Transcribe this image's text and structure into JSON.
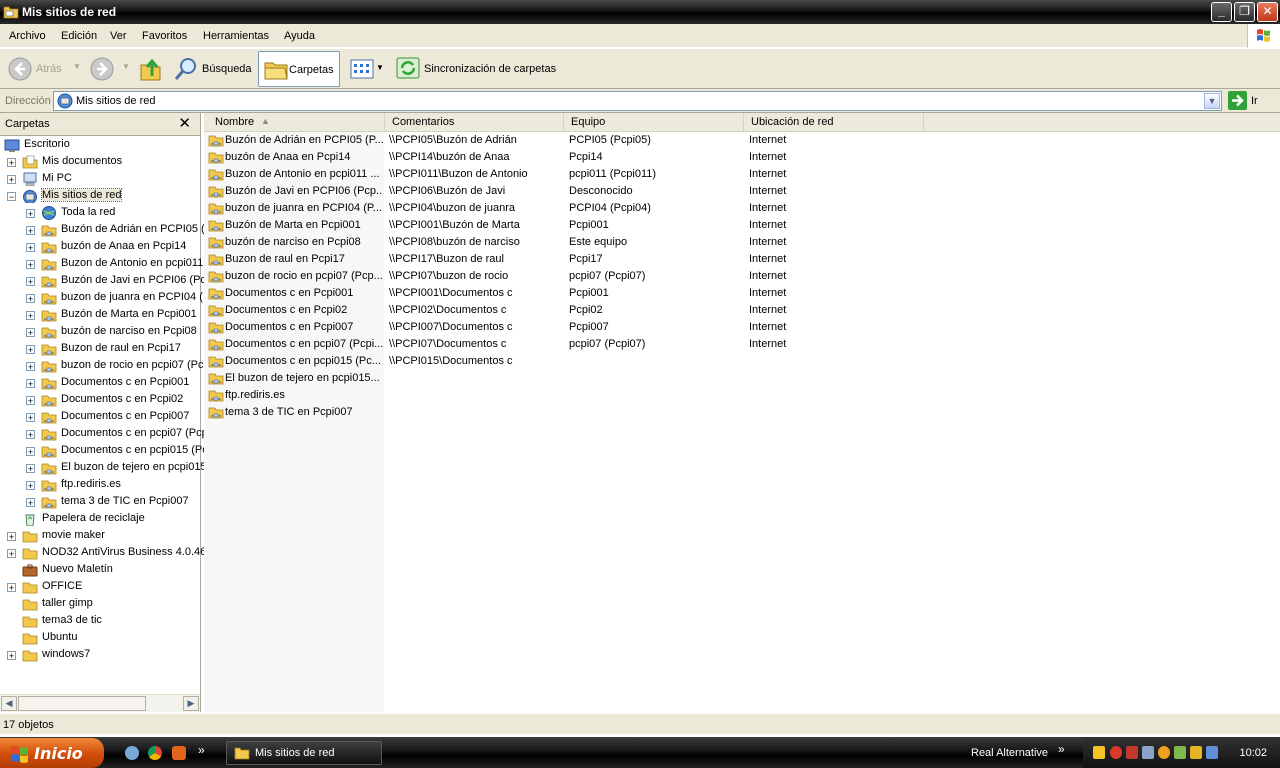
{
  "window": {
    "title": "Mis sitios de red",
    "controls": {
      "minimize": "_",
      "maximize": "❐",
      "close": "✕"
    }
  },
  "menu": [
    "Archivo",
    "Edición",
    "Ver",
    "Favoritos",
    "Herramientas",
    "Ayuda"
  ],
  "toolbar": {
    "back_label": "Atrás",
    "search_label": "Búsqueda",
    "folders_label": "Carpetas",
    "sync_label": "Sincronización de carpetas"
  },
  "address": {
    "label": "Dirección",
    "value": "Mis sitios de red",
    "go_label": "Ir"
  },
  "folder_pane": {
    "title": "Carpetas",
    "close_glyph": "✕",
    "tree": [
      {
        "label": "Escritorio",
        "level": 0,
        "expander": "",
        "icon": "desktop-icon"
      },
      {
        "label": "Mis documentos",
        "level": 1,
        "expander": "+",
        "icon": "my-documents-icon"
      },
      {
        "label": "Mi PC",
        "level": 1,
        "expander": "+",
        "icon": "my-computer-icon"
      },
      {
        "label": "Mis sitios de red",
        "level": 1,
        "expander": "−",
        "icon": "network-places-icon",
        "selected": true
      },
      {
        "label": "Toda la red",
        "level": 2,
        "expander": "+",
        "icon": "globe-icon"
      },
      {
        "label": "Buzón de Adrián en PCPI05 (",
        "level": 2,
        "expander": "+",
        "icon": "network-folder-icon"
      },
      {
        "label": "buzón de Anaa en Pcpi14",
        "level": 2,
        "expander": "+",
        "icon": "network-folder-icon"
      },
      {
        "label": "Buzon de Antonio en pcpi011",
        "level": 2,
        "expander": "+",
        "icon": "network-folder-icon"
      },
      {
        "label": "Buzón de Javi en PCPI06 (Pc",
        "level": 2,
        "expander": "+",
        "icon": "network-folder-icon"
      },
      {
        "label": "buzon de juanra en PCPI04 (",
        "level": 2,
        "expander": "+",
        "icon": "network-folder-icon"
      },
      {
        "label": "Buzón de Marta en Pcpi001",
        "level": 2,
        "expander": "+",
        "icon": "network-folder-icon"
      },
      {
        "label": "buzón de narciso en Pcpi08",
        "level": 2,
        "expander": "+",
        "icon": "network-folder-icon"
      },
      {
        "label": "Buzon de raul en Pcpi17",
        "level": 2,
        "expander": "+",
        "icon": "network-folder-icon"
      },
      {
        "label": "buzon de rocio en pcpi07 (Pc",
        "level": 2,
        "expander": "+",
        "icon": "network-folder-icon"
      },
      {
        "label": "Documentos c en Pcpi001",
        "level": 2,
        "expander": "+",
        "icon": "network-folder-icon"
      },
      {
        "label": "Documentos c en Pcpi02",
        "level": 2,
        "expander": "+",
        "icon": "network-folder-icon"
      },
      {
        "label": "Documentos c en Pcpi007",
        "level": 2,
        "expander": "+",
        "icon": "network-folder-icon"
      },
      {
        "label": "Documentos c en pcpi07 (Pcp",
        "level": 2,
        "expander": "+",
        "icon": "network-folder-icon"
      },
      {
        "label": "Documentos c en pcpi015 (Pc",
        "level": 2,
        "expander": "+",
        "icon": "network-folder-icon"
      },
      {
        "label": "El buzon de tejero en pcpi015",
        "level": 2,
        "expander": "+",
        "icon": "network-folder-icon"
      },
      {
        "label": "ftp.rediris.es",
        "level": 2,
        "expander": "+",
        "icon": "network-folder-icon"
      },
      {
        "label": "tema 3 de TIC en Pcpi007",
        "level": 2,
        "expander": "+",
        "icon": "network-folder-icon"
      },
      {
        "label": "Papelera de reciclaje",
        "level": 1,
        "expander": "",
        "icon": "recycle-bin-icon"
      },
      {
        "label": "movie maker",
        "level": 1,
        "expander": "+",
        "icon": "folder-icon"
      },
      {
        "label": "NOD32 AntiVirus Business 4.0.46",
        "level": 1,
        "expander": "+",
        "icon": "folder-icon"
      },
      {
        "label": "Nuevo Maletín",
        "level": 1,
        "expander": "",
        "icon": "briefcase-icon"
      },
      {
        "label": "OFFICE",
        "level": 1,
        "expander": "+",
        "icon": "folder-icon"
      },
      {
        "label": "taller gimp",
        "level": 1,
        "expander": "",
        "icon": "folder-icon"
      },
      {
        "label": "tema3 de tic",
        "level": 1,
        "expander": "",
        "icon": "folder-icon"
      },
      {
        "label": "Ubuntu",
        "level": 1,
        "expander": "",
        "icon": "folder-icon"
      },
      {
        "label": "windows7",
        "level": 1,
        "expander": "+",
        "icon": "folder-icon"
      }
    ]
  },
  "list": {
    "columns": [
      "Nombre",
      "Comentarios",
      "Equipo",
      "Ubicación de red"
    ],
    "sort_indicator": "▲",
    "rows": [
      {
        "name": "Buzón de Adrián en PCPI05 (P...",
        "comment": "\\\\PCPI05\\Buzón de Adrián",
        "computer": "PCPI05 (Pcpi05)",
        "location": "Internet"
      },
      {
        "name": "buzón de Anaa en Pcpi14",
        "comment": "\\\\PCPI14\\buzón de Anaa",
        "computer": "Pcpi14",
        "location": "Internet"
      },
      {
        "name": "Buzon de Antonio en pcpi011 ...",
        "comment": "\\\\PCPI011\\Buzon de Antonio",
        "computer": "pcpi011 (Pcpi011)",
        "location": "Internet"
      },
      {
        "name": "Buzón de Javi en PCPI06 (Pcp...",
        "comment": "\\\\PCPI06\\Buzón de Javi",
        "computer": "Desconocido",
        "location": "Internet"
      },
      {
        "name": "buzon de juanra en PCPI04 (P...",
        "comment": "\\\\PCPI04\\buzon de juanra",
        "computer": "PCPI04 (Pcpi04)",
        "location": "Internet"
      },
      {
        "name": "Buzón de Marta en Pcpi001",
        "comment": "\\\\PCPI001\\Buzón de Marta",
        "computer": "Pcpi001",
        "location": "Internet"
      },
      {
        "name": "buzón de narciso en Pcpi08",
        "comment": "\\\\PCPI08\\buzón de narciso",
        "computer": "Este equipo",
        "location": "Internet"
      },
      {
        "name": "Buzon de raul en Pcpi17",
        "comment": "\\\\PCPI17\\Buzon de raul",
        "computer": "Pcpi17",
        "location": "Internet"
      },
      {
        "name": "buzon de rocio en pcpi07 (Pcp...",
        "comment": "\\\\PCPI07\\buzon de rocio",
        "computer": "pcpi07 (Pcpi07)",
        "location": "Internet"
      },
      {
        "name": "Documentos c en Pcpi001",
        "comment": "\\\\PCPI001\\Documentos c",
        "computer": "Pcpi001",
        "location": "Internet"
      },
      {
        "name": "Documentos c en Pcpi02",
        "comment": "\\\\PCPI02\\Documentos c",
        "computer": "Pcpi02",
        "location": "Internet"
      },
      {
        "name": "Documentos c en Pcpi007",
        "comment": "\\\\PCPI007\\Documentos c",
        "computer": "Pcpi007",
        "location": "Internet"
      },
      {
        "name": "Documentos c en pcpi07 (Pcpi...",
        "comment": "\\\\PCPI07\\Documentos c",
        "computer": "pcpi07 (Pcpi07)",
        "location": "Internet"
      },
      {
        "name": "Documentos c en pcpi015 (Pc...",
        "comment": "\\\\PCPI015\\Documentos c",
        "computer": "",
        "location": ""
      },
      {
        "name": "El buzon de tejero en pcpi015...",
        "comment": "",
        "computer": "",
        "location": ""
      },
      {
        "name": "ftp.rediris.es",
        "comment": "",
        "computer": "",
        "location": ""
      },
      {
        "name": "tema 3 de TIC en Pcpi007",
        "comment": "",
        "computer": "",
        "location": ""
      }
    ]
  },
  "status": {
    "text": "17 objetos"
  },
  "taskbar": {
    "start_label": "Inicio",
    "window_button": "Mis sitios de red",
    "tray_app": "Real Alternative",
    "chevron": "»",
    "clock": "10:02"
  },
  "colors": {
    "titlebar": "#151515",
    "chrome": "#ece9d8",
    "start": "#d14d0a",
    "folder": "#f2c94c",
    "go_arrow": "#2fa337"
  }
}
